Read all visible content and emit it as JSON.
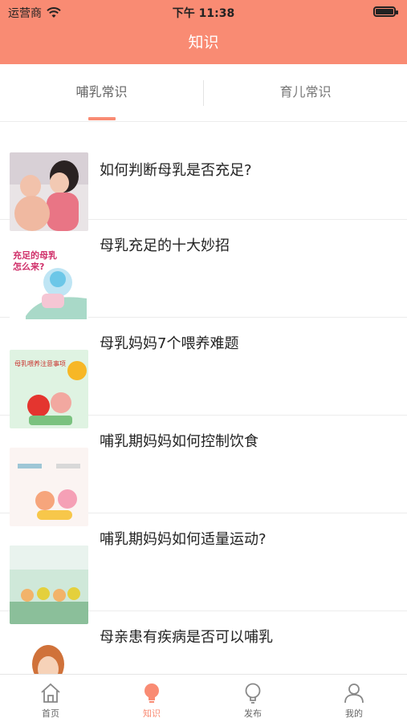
{
  "status": {
    "carrier": "运营商",
    "time": "下午 11:38",
    "icons": [
      "wifi-icon",
      "battery-icon"
    ]
  },
  "nav": {
    "title": "知识"
  },
  "tabs": [
    {
      "label": "哺乳常识",
      "selected": true
    },
    {
      "label": "育儿常识",
      "selected": false
    }
  ],
  "articles": [
    {
      "title": "如何判断母乳是否充足?",
      "thumb_text": ""
    },
    {
      "title": "母乳充足的十大妙招",
      "thumb_text": "充足的母乳 怎么来?"
    },
    {
      "title": "母乳妈妈7个喂养难题",
      "thumb_text": "母乳喂养注意事项"
    },
    {
      "title": "哺乳期妈妈如何控制饮食",
      "thumb_text": ""
    },
    {
      "title": "哺乳期妈妈如何适量运动?",
      "thumb_text": ""
    },
    {
      "title": "母亲患有疾病是否可以哺乳",
      "thumb_text": ""
    }
  ],
  "tabbar": [
    {
      "label": "首页",
      "icon": "home-icon",
      "active": false
    },
    {
      "label": "知识",
      "icon": "lightbulb-icon",
      "active": true
    },
    {
      "label": "发布",
      "icon": "lightbulb-outline-icon",
      "active": false
    },
    {
      "label": "我的",
      "icon": "user-icon",
      "active": false
    }
  ],
  "colors": {
    "accent": "#f98b73",
    "tab_inactive": "#777777",
    "divider": "#ececec"
  }
}
